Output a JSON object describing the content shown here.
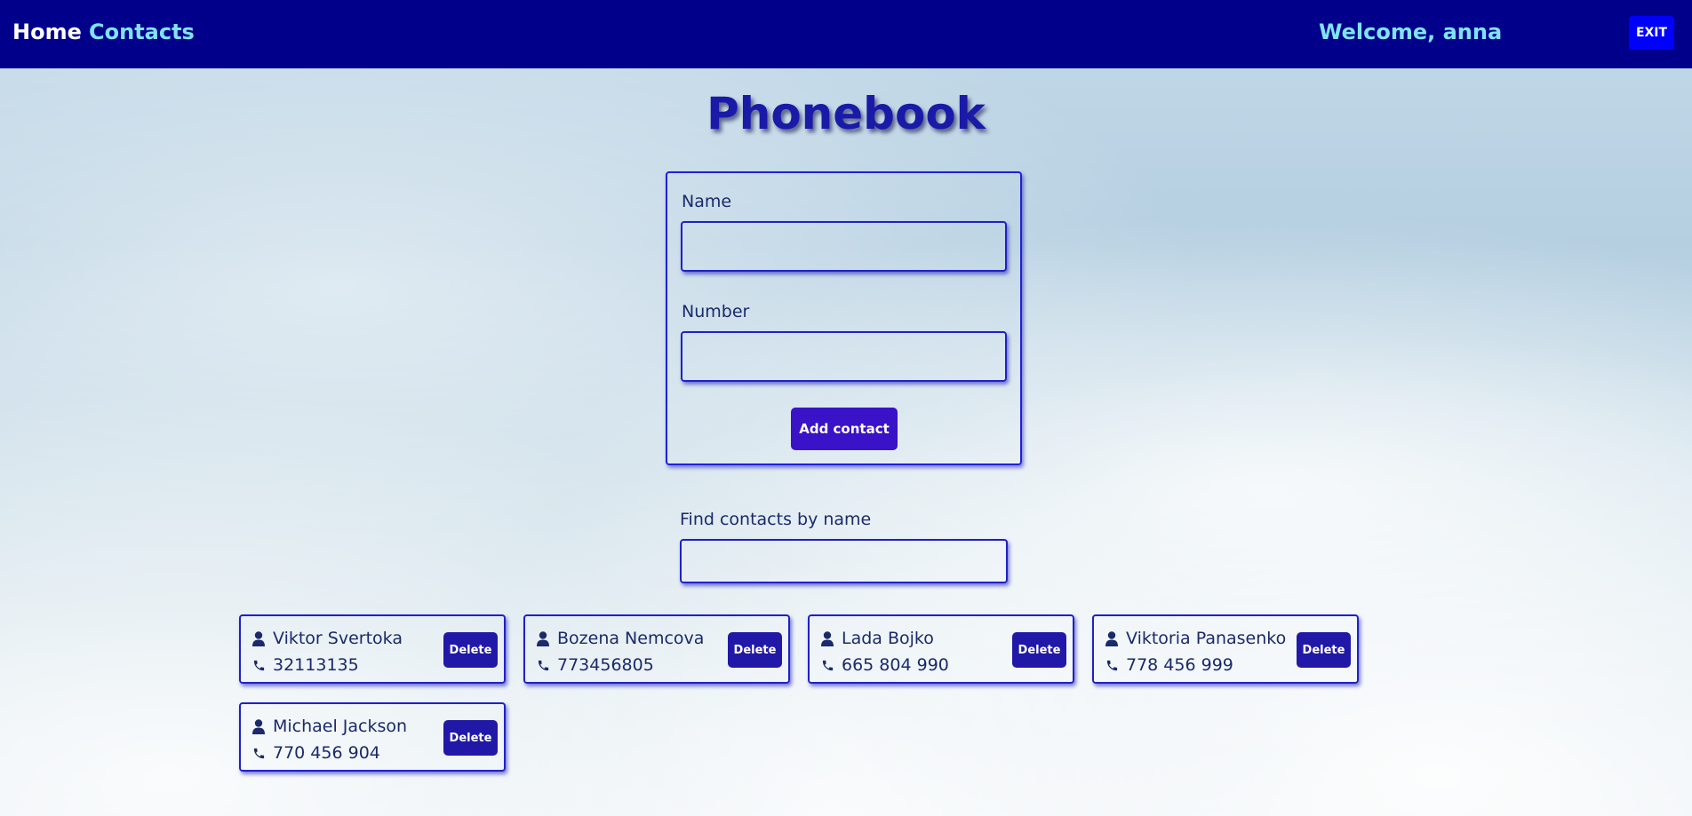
{
  "header": {
    "home_label": "Home",
    "contacts_label": "Contacts",
    "welcome_text": "Welcome, anna",
    "exit_label": "EXIT"
  },
  "page": {
    "title": "Phonebook"
  },
  "form": {
    "name_label": "Name",
    "name_value": "",
    "number_label": "Number",
    "number_value": "",
    "add_button_label": "Add contact"
  },
  "filter": {
    "label": "Find contacts by name",
    "value": ""
  },
  "contacts": [
    {
      "name": "Viktor Svertoka",
      "number": "32113135",
      "delete_label": "Delete"
    },
    {
      "name": "Bozena Nemcova",
      "number": "773456805",
      "delete_label": "Delete"
    },
    {
      "name": "Lada Bojko",
      "number": "665 804 990",
      "delete_label": "Delete"
    },
    {
      "name": "Viktoria Panasenko",
      "number": "778 456 999",
      "delete_label": "Delete"
    },
    {
      "name": "Michael Jackson",
      "number": "770 456 904",
      "delete_label": "Delete"
    }
  ],
  "icons": {
    "person": "user-icon",
    "phone": "phone-icon"
  },
  "colors": {
    "header_bg": "#00008b",
    "nav_active": "#7fe3f5",
    "exit_button": "#0000ff",
    "title": "#1a1aa8",
    "border_accent": "#2020c8",
    "add_button": "#3a12c8",
    "delete_button": "#2218a8",
    "text": "#1a2a6a"
  }
}
